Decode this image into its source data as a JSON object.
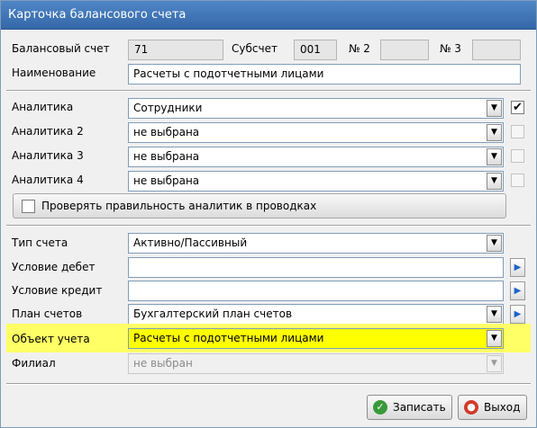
{
  "window": {
    "title": "Карточка балансового счета"
  },
  "account": {
    "label": "Балансовый счет",
    "value": "71",
    "sub_label": "Субсчет",
    "sub_value": "001",
    "n2_label": "№ 2",
    "n2_value": "",
    "n3_label": "№ 3",
    "n3_value": ""
  },
  "name": {
    "label": "Наименование",
    "value": "Расчеты с подотчетными лицами"
  },
  "analytics": [
    {
      "label": "Аналитика",
      "value": "Сотрудники",
      "checked": "✔"
    },
    {
      "label": "Аналитика 2",
      "value": "не выбрана",
      "checked": ""
    },
    {
      "label": "Аналитика 3",
      "value": "не выбрана",
      "checked": ""
    },
    {
      "label": "Аналитика 4",
      "value": "не выбрана",
      "checked": ""
    }
  ],
  "verify": {
    "label": "Проверять правильность аналитик в проводках",
    "checked": ""
  },
  "account_type": {
    "label": "Тип счета",
    "value": "Активно/Пассивный"
  },
  "debit_condition": {
    "label": "Условие дебет",
    "value": ""
  },
  "credit_condition": {
    "label": "Условие кредит",
    "value": ""
  },
  "chart_of_accounts": {
    "label": "План счетов",
    "value": "Бухгалтерский план счетов"
  },
  "accounting_object": {
    "label": "Объект учета",
    "value": "Расчеты с подотчетными лицами"
  },
  "branch": {
    "label": "Филиал",
    "value": "не выбран"
  },
  "buttons": {
    "save": "Записать",
    "exit": "Выход"
  },
  "icons": {
    "dropdown": "▼",
    "arrow": "▶",
    "save_glyph": "✓",
    "exit_glyph": "●"
  },
  "colors": {
    "highlight": "#ffff00",
    "title_bar": "#3f78b8"
  }
}
